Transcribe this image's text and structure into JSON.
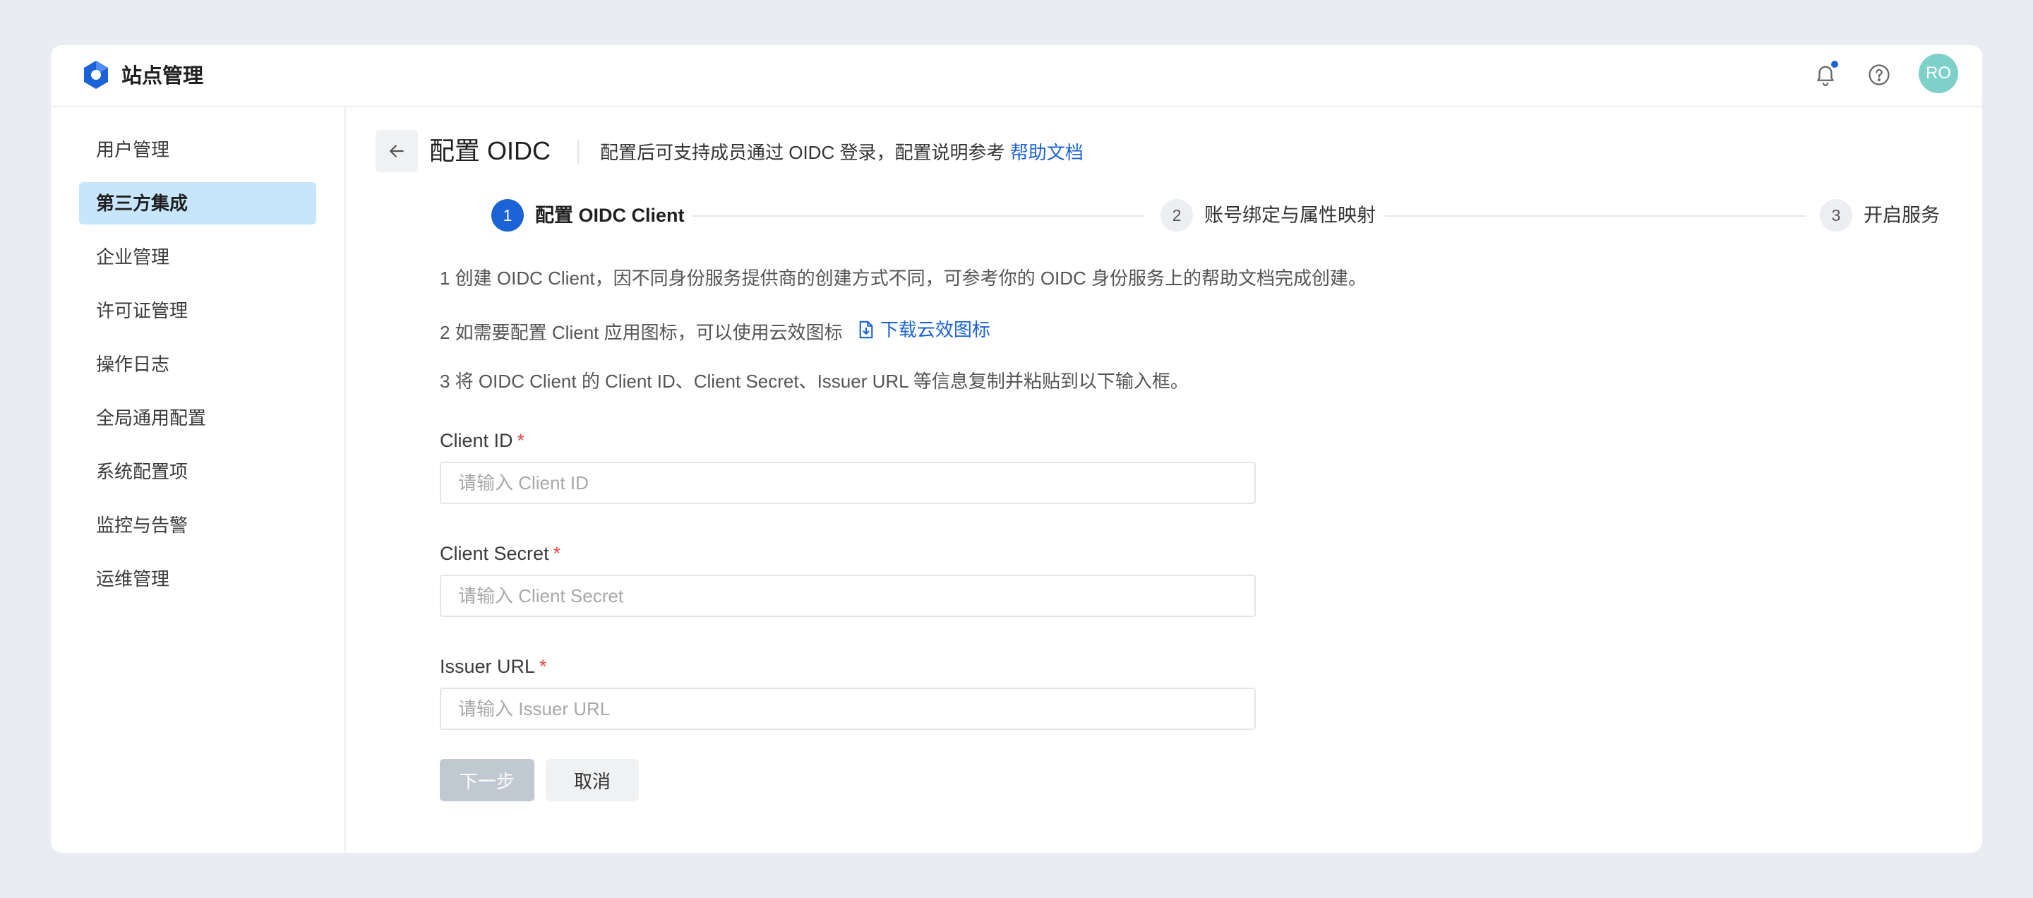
{
  "header": {
    "app_title": "站点管理",
    "avatar_text": "RO",
    "logo_icon": "hexagon-logo-icon",
    "notification_icon": "bell-icon",
    "help_icon": "question-icon",
    "accent_color": "#1b62d6"
  },
  "sidebar": {
    "items": [
      {
        "label": "用户管理"
      },
      {
        "label": "第三方集成"
      },
      {
        "label": "企业管理"
      },
      {
        "label": "许可证管理"
      },
      {
        "label": "操作日志"
      },
      {
        "label": "全局通用配置"
      },
      {
        "label": "系统配置项"
      },
      {
        "label": "监控与告警"
      },
      {
        "label": "运维管理"
      }
    ],
    "active": "第三方集成"
  },
  "page": {
    "title": "配置 OIDC",
    "description": "配置后可支持成员通过 OIDC 登录，配置说明参考",
    "help_link": "帮助文档"
  },
  "steps": [
    {
      "number": "1",
      "label": "配置 OIDC Client"
    },
    {
      "number": "2",
      "label": "账号绑定与属性映射"
    },
    {
      "number": "3",
      "label": "开启服务"
    }
  ],
  "instructions": {
    "line1": "1 创建 OIDC Client，因不同身份服务提供商的创建方式不同，可参考你的 OIDC 身份服务上的帮助文档完成创建。",
    "line2": "2 如需要配置 Client 应用图标，可以使用云效图标",
    "line2_link": "下载云效图标",
    "line3": "3 将 OIDC Client 的 Client ID、Client Secret、Issuer URL 等信息复制并粘贴到以下输入框。"
  },
  "form": {
    "client_id": {
      "label": "Client ID",
      "required_mark": "*",
      "placeholder": "请输入 Client ID",
      "value": ""
    },
    "client_secret": {
      "label": "Client Secret",
      "required_mark": "*",
      "placeholder": "请输入 Client Secret",
      "value": ""
    },
    "issuer_url": {
      "label": "Issuer URL",
      "required_mark": "*",
      "placeholder": "请输入 Issuer URL",
      "value": ""
    }
  },
  "buttons": {
    "next": "下一步",
    "cancel": "取消"
  }
}
